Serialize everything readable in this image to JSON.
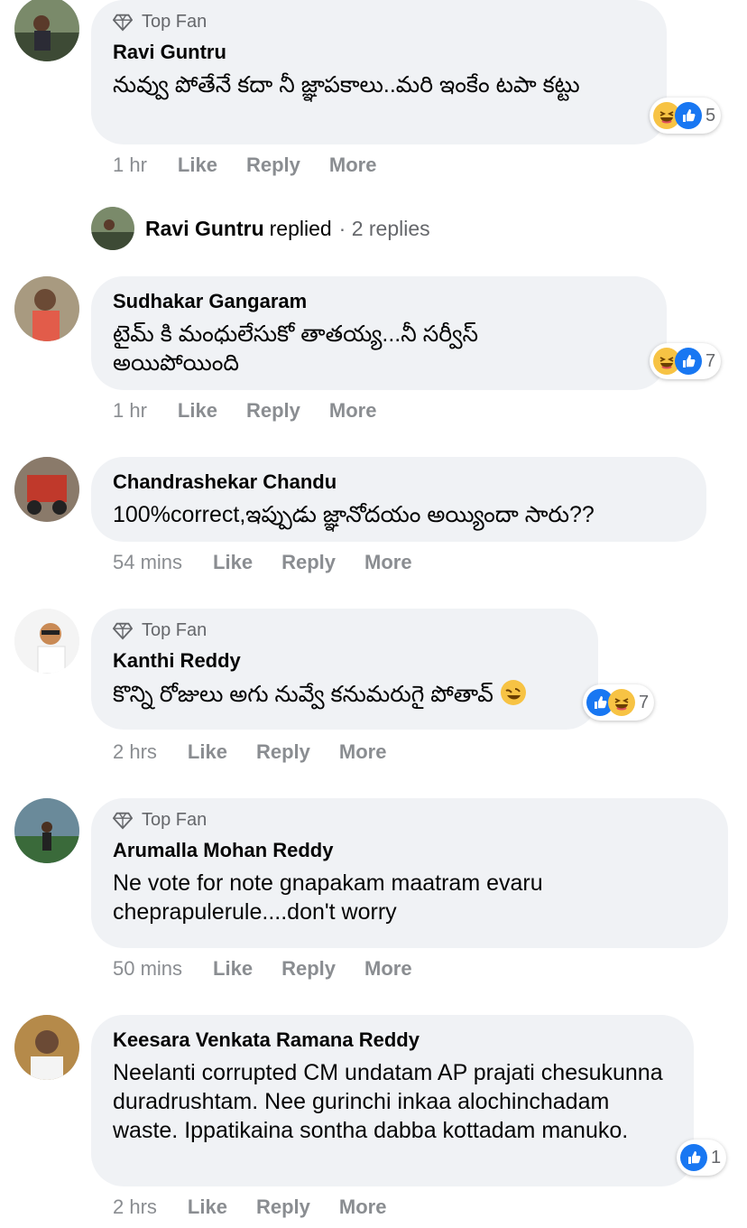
{
  "comments": [
    {
      "top_fan_label": "Top Fan",
      "name": "Ravi Guntru",
      "text": "నువ్వు పోతేనే కదా నీ జ్ఞాపకాలు..మరి ఇంకేం టపా కట్టు",
      "time": "1 hr",
      "like": "Like",
      "reply": "Reply",
      "more": "More",
      "reaction_count": "5"
    },
    {
      "name": "Sudhakar Gangaram",
      "text": "టైమ్ కి మంధులేసుకో తాతయ్య...నీ సర్వీస్ అయిపోయింది",
      "time": "1 hr",
      "like": "Like",
      "reply": "Reply",
      "more": "More",
      "reaction_count": "7"
    },
    {
      "name": "Chandrashekar Chandu",
      "text": "100%correct,ఇప్పుడు జ్ఞానోదయం అయ్యిందా సారు??",
      "time": "54 mins",
      "like": "Like",
      "reply": "Reply",
      "more": "More"
    },
    {
      "top_fan_label": "Top Fan",
      "name": "Kanthi Reddy",
      "text": "కొన్ని రోజులు అగు నువ్వే కనుమరుగై పోతావ్",
      "time": "2 hrs",
      "like": "Like",
      "reply": "Reply",
      "more": "More",
      "reaction_count": "7"
    },
    {
      "top_fan_label": "Top Fan",
      "name": "Arumalla Mohan Reddy",
      "text": "Ne vote for note gnapakam maatram evaru cheprapulerule....don't worry",
      "time": "50 mins",
      "like": "Like",
      "reply": "Reply",
      "more": "More"
    },
    {
      "name": "Keesara Venkata Ramana Reddy",
      "text": "Neelanti corrupted CM undatam AP prajati chesukunna duradrushtam. Nee gurinchi inkaa alochinchadam waste. Ippatikaina sontha dabba kottadam manuko.",
      "time": "2 hrs",
      "like": "Like",
      "reply": "Reply",
      "more": "More",
      "reaction_count": "1"
    }
  ],
  "reply_summary": {
    "name": "Ravi Guntru",
    "action": "replied",
    "count": "· 2 replies"
  },
  "icons": {
    "top_fan": "diamond-icon",
    "like_reaction": "like-reaction-icon",
    "haha_reaction": "haha-reaction-icon"
  },
  "colors": {
    "bubble": "#f0f2f5",
    "meta": "#8a8d91",
    "like_blue": "#1877f2",
    "haha_yellow": "#f7c344"
  }
}
